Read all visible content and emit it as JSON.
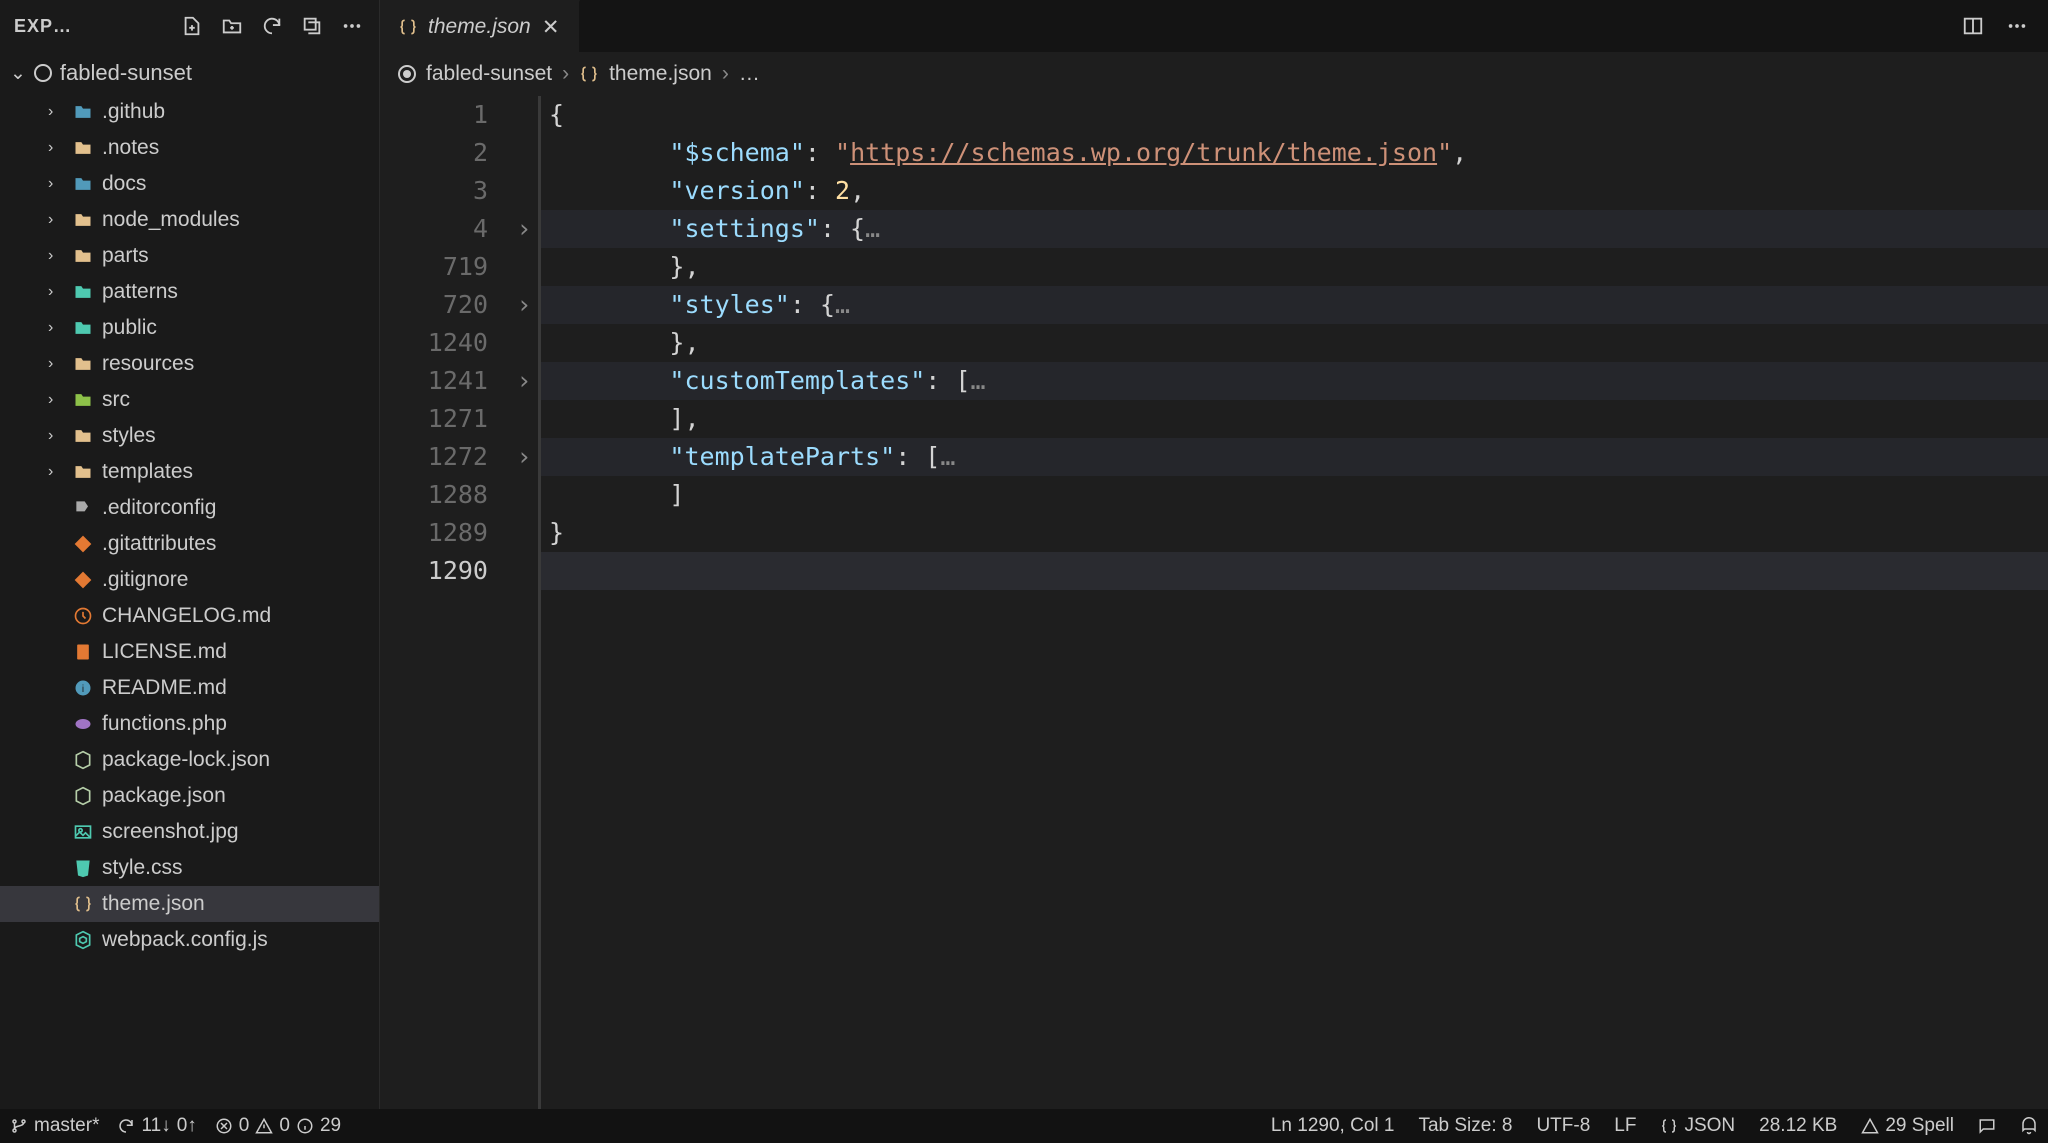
{
  "sidebar": {
    "title": "EXP…",
    "project": "fabled-sunset",
    "items": [
      {
        "label": ".github",
        "type": "folder",
        "color": "fc-blue"
      },
      {
        "label": ".notes",
        "type": "folder",
        "color": "fc-yellow"
      },
      {
        "label": "docs",
        "type": "folder",
        "color": "fc-blue"
      },
      {
        "label": "node_modules",
        "type": "folder",
        "color": "fc-yellow"
      },
      {
        "label": "parts",
        "type": "folder",
        "color": "fc-yellow"
      },
      {
        "label": "patterns",
        "type": "folder",
        "color": "fc-cyan"
      },
      {
        "label": "public",
        "type": "folder",
        "color": "fc-cyan"
      },
      {
        "label": "resources",
        "type": "folder",
        "color": "fc-yellow"
      },
      {
        "label": "src",
        "type": "folder",
        "color": "fc-green"
      },
      {
        "label": "styles",
        "type": "folder",
        "color": "fc-yellow"
      },
      {
        "label": "templates",
        "type": "folder",
        "color": "fc-yellow"
      },
      {
        "label": ".editorconfig",
        "type": "file",
        "color": "fc-gray"
      },
      {
        "label": ".gitattributes",
        "type": "file",
        "color": "fc-orange"
      },
      {
        "label": ".gitignore",
        "type": "file",
        "color": "fc-orange"
      },
      {
        "label": "CHANGELOG.md",
        "type": "file",
        "color": "fc-orange"
      },
      {
        "label": "LICENSE.md",
        "type": "file",
        "color": "fc-orange"
      },
      {
        "label": "README.md",
        "type": "file",
        "color": "fc-blue"
      },
      {
        "label": "functions.php",
        "type": "file",
        "color": "fc-purple"
      },
      {
        "label": "package-lock.json",
        "type": "file",
        "color": "fc-lime"
      },
      {
        "label": "package.json",
        "type": "file",
        "color": "fc-lime"
      },
      {
        "label": "screenshot.jpg",
        "type": "file",
        "color": "fc-cyan"
      },
      {
        "label": "style.css",
        "type": "file",
        "color": "fc-cyan"
      },
      {
        "label": "theme.json",
        "type": "file",
        "color": "fc-yellow",
        "active": true
      },
      {
        "label": "webpack.config.js",
        "type": "file",
        "color": "fc-cyan"
      }
    ]
  },
  "tab": {
    "filename": "theme.json"
  },
  "breadcrumb": {
    "project": "fabled-sunset",
    "file": "theme.json",
    "rest": "…"
  },
  "code": {
    "lines": [
      {
        "num": "1",
        "fold": "",
        "hl": false
      },
      {
        "num": "2",
        "fold": "",
        "hl": false
      },
      {
        "num": "3",
        "fold": "",
        "hl": false
      },
      {
        "num": "4",
        "fold": "›",
        "hl": true
      },
      {
        "num": "719",
        "fold": "",
        "hl": false
      },
      {
        "num": "720",
        "fold": "›",
        "hl": true
      },
      {
        "num": "1240",
        "fold": "",
        "hl": false
      },
      {
        "num": "1241",
        "fold": "›",
        "hl": true
      },
      {
        "num": "1271",
        "fold": "",
        "hl": false
      },
      {
        "num": "1272",
        "fold": "›",
        "hl": true
      },
      {
        "num": "1288",
        "fold": "",
        "hl": false
      },
      {
        "num": "1289",
        "fold": "",
        "hl": false
      },
      {
        "num": "1290",
        "fold": "",
        "hl": true,
        "current": true
      }
    ],
    "content": {
      "schema_key": "\"$schema\"",
      "schema_val": "\"https://schemas.wp.org/trunk/theme.json\"",
      "version_key": "\"version\"",
      "version_val": "2",
      "settings_key": "\"settings\"",
      "styles_key": "\"styles\"",
      "customTemplates_key": "\"customTemplates\"",
      "templateParts_key": "\"templateParts\""
    }
  },
  "statusbar": {
    "branch": "master*",
    "sync_down": "11↓",
    "sync_up": "0↑",
    "errors": "0",
    "warnings": "0",
    "info": "29",
    "position": "Ln 1290, Col 1",
    "tabsize": "Tab Size: 8",
    "encoding": "UTF-8",
    "eol": "LF",
    "lang": "JSON",
    "size": "28.12 KB",
    "spell": "29 Spell"
  }
}
